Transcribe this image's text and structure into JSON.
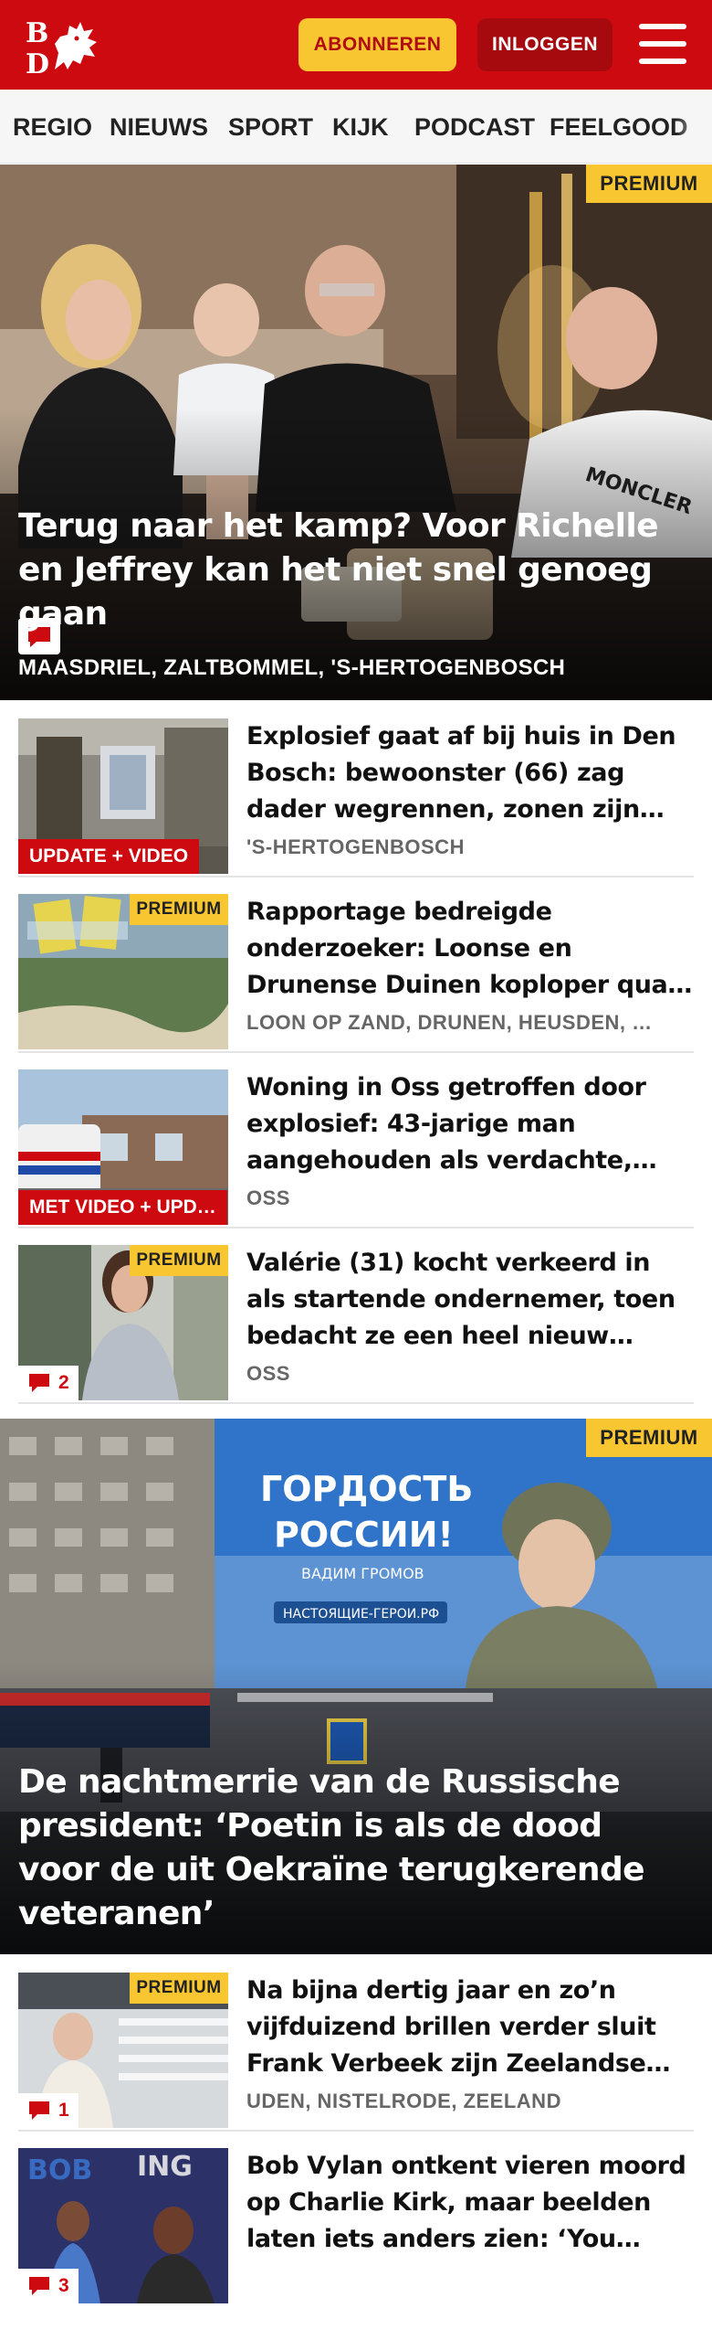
{
  "header": {
    "logo_text": "BD",
    "subscribe_label": "ABONNEREN",
    "login_label": "INLOGGEN"
  },
  "nav": {
    "items": [
      "REGIO",
      "NIEUWS",
      "SPORT",
      "KIJK",
      "PODCAST",
      "FEELGOOD"
    ]
  },
  "hero1": {
    "badge": "PREMIUM",
    "title": "Terug naar het kamp? Voor Richelle en Jeffrey kan het niet snel genoeg gaan",
    "location": "MAASDRIEL, ZALTBOMMEL, 'S-HERTOGENBOSCH",
    "icons": [
      "comment-icon"
    ]
  },
  "articles": [
    {
      "title": "Explosief gaat af bij huis in Den Bosch: bewoonster (66) zag dader wegrennen, zonen zijn…",
      "location": "'S-HERTOGENBOSCH",
      "label": "UPDATE + VIDEO"
    },
    {
      "title": "Rapportage bedreigde onderzoe­ker: Loonse en Drunense Duinen koploper qua pesticiden",
      "location": "LOON OP ZAND, DRUNEN, HEUSDEN, …",
      "badge": "PREMIUM"
    },
    {
      "title": "Woning in Oss getroffen door explosief: 43-jarige man aangehouden als verdachte,…",
      "location": "OSS",
      "label": "MET VIDEO + UPD…"
    },
    {
      "title": "Valérie (31) kocht verkeerd in als startende ondernemer, toen bedacht ze een heel nieuw…",
      "location": "OSS",
      "badge": "PREMIUM",
      "comments": "2"
    }
  ],
  "hero2": {
    "badge": "PREMIUM",
    "title": "De nachtmerrie van de Russische president: ‘Poetin is als de dood voor de uit Oekraïne terugkerende veteranen’",
    "billboard_line1": "ГОРДОСТЬ",
    "billboard_line2": "РОССИИ!",
    "billboard_name": "ВАДИМ ГРОМОВ",
    "billboard_url": "НАСТОЯЩИЕ-ГЕРОИ.РФ"
  },
  "articles2": [
    {
      "title": "Na bijna dertig jaar en zo’n vijfduizend brillen verder sluit Frank Verbeek zijn Zeelandse…",
      "location": "UDEN, NISTELRODE, ZEELAND",
      "badge": "PREMIUM",
      "comments": "1"
    },
    {
      "title": "Bob Vylan ontkent vieren moord op Charlie Kirk, maar beelden laten iets anders zien: ‘You will…",
      "location": "",
      "comments": "3"
    }
  ],
  "colors": {
    "brand_red": "#cc0a10",
    "premium_yellow": "#f7c631",
    "location_gray": "#666666"
  }
}
